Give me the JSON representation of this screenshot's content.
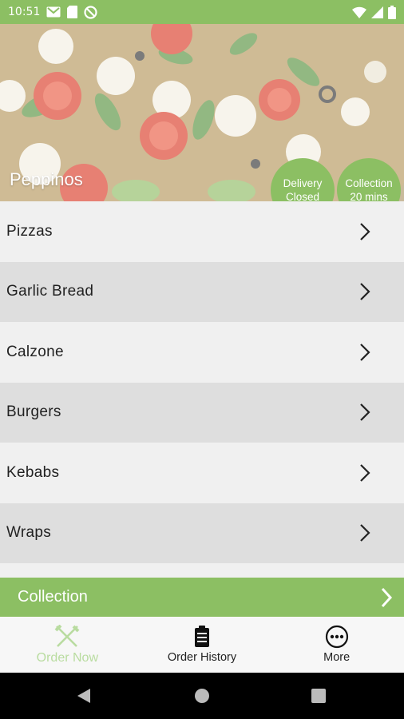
{
  "status": {
    "time": "10:51"
  },
  "hero": {
    "restaurant_name": "Peppinos",
    "delivery_badge": {
      "line1": "Delivery",
      "line2": "Closed"
    },
    "collection_badge": {
      "line1": "Collection",
      "line2": "20 mins"
    }
  },
  "menu": {
    "items": [
      {
        "label": "Pizzas"
      },
      {
        "label": "Garlic Bread"
      },
      {
        "label": "Calzone"
      },
      {
        "label": "Burgers"
      },
      {
        "label": "Kebabs"
      },
      {
        "label": "Wraps"
      }
    ]
  },
  "order_mode": {
    "label": "Collection"
  },
  "tabs": [
    {
      "label": "Order Now",
      "icon": "fork-knife-icon"
    },
    {
      "label": "Order History",
      "icon": "clipboard-icon"
    },
    {
      "label": "More",
      "icon": "more-dots-icon"
    }
  ],
  "colors": {
    "accent": "#8cbf63",
    "active_tab": "#b9dca0"
  }
}
